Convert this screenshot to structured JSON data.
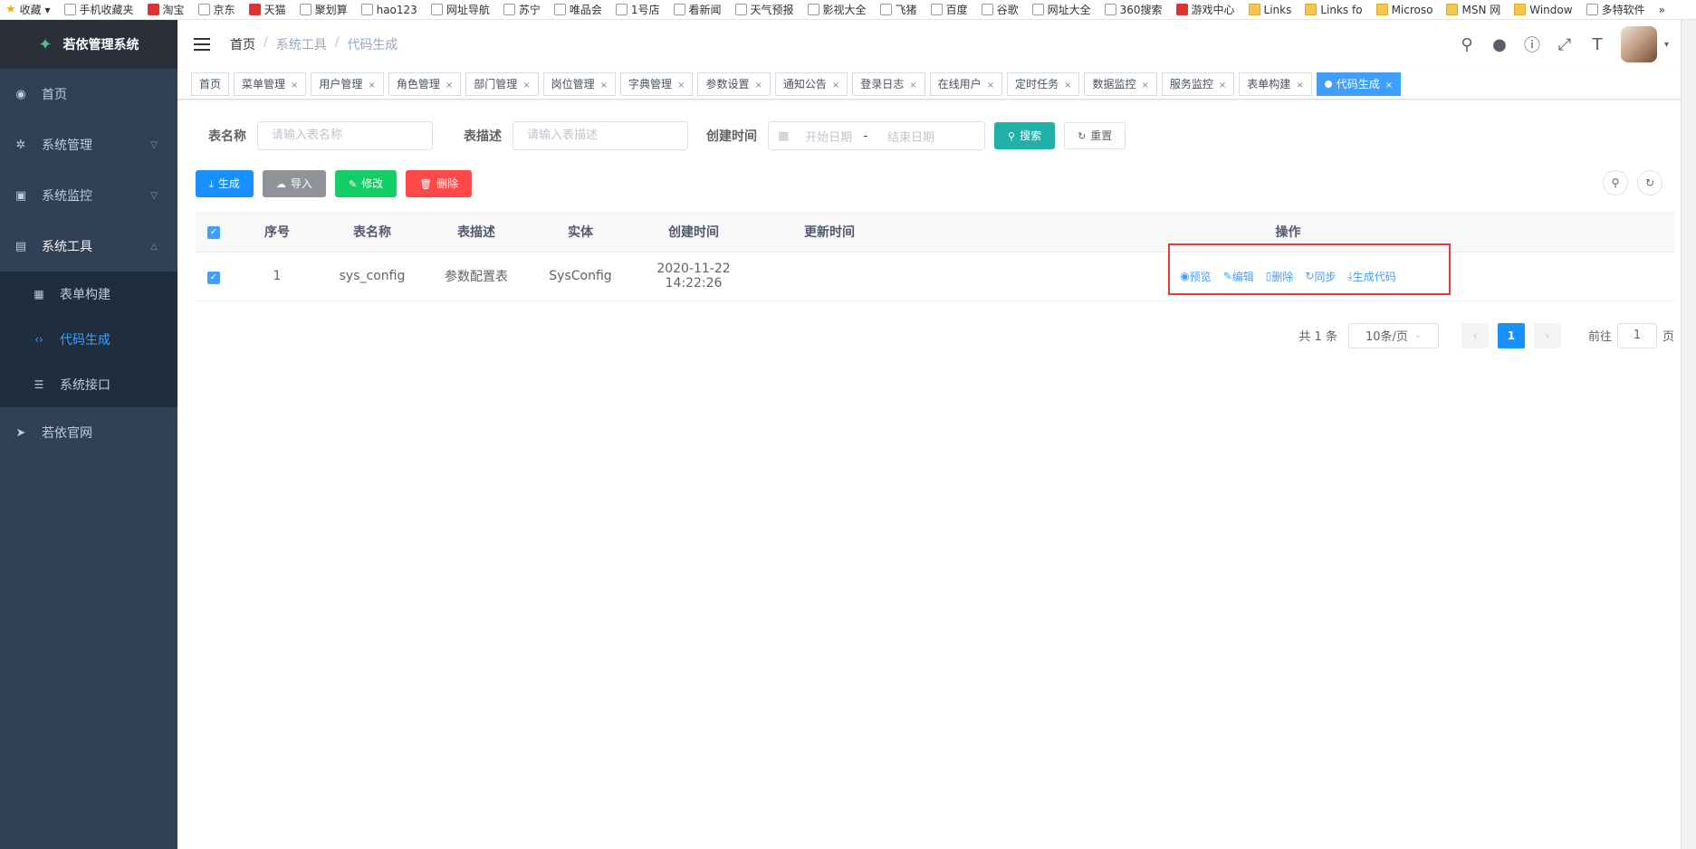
{
  "bookmarks": [
    "收藏",
    "手机收藏夹",
    "淘宝",
    "京东",
    "天猫",
    "聚划算",
    "hao123",
    "网址导航",
    "苏宁",
    "唯品会",
    "1号店",
    "看新闻",
    "天气预报",
    "影视大全",
    "飞猪",
    "百度",
    "谷歌",
    "网址大全",
    "360搜索",
    "游戏中心",
    "Links",
    "Links fo",
    "Microso",
    "MSN 网",
    "Window",
    "多特软件"
  ],
  "bookmarks_more": "»",
  "app_title": "若依管理系统",
  "sidebar": {
    "home": "首页",
    "system": "系统管理",
    "monitor": "系统监控",
    "tools": "系统工具",
    "form_build": "表单构建",
    "code_gen": "代码生成",
    "api": "系统接口",
    "site": "若依官网"
  },
  "breadcrumb": [
    "首页",
    "系统工具",
    "代码生成"
  ],
  "tabs": [
    "首页",
    "菜单管理",
    "用户管理",
    "角色管理",
    "部门管理",
    "岗位管理",
    "字典管理",
    "参数设置",
    "通知公告",
    "登录日志",
    "在线用户",
    "定时任务",
    "数据监控",
    "服务监控",
    "表单构建"
  ],
  "active_tab": "代码生成",
  "search": {
    "table_name_label": "表名称",
    "table_name_placeholder": "请输入表名称",
    "table_desc_label": "表描述",
    "table_desc_placeholder": "请输入表描述",
    "create_time_label": "创建时间",
    "start_date": "开始日期",
    "date_sep": "-",
    "end_date": "结束日期",
    "search_btn": "搜索",
    "reset_btn": "重置"
  },
  "toolbar": {
    "generate": "生成",
    "import": "导入",
    "edit": "修改",
    "delete": "删除"
  },
  "table": {
    "headers": [
      "序号",
      "表名称",
      "表描述",
      "实体",
      "创建时间",
      "更新时间",
      "操作"
    ],
    "rows": [
      {
        "index": "1",
        "table_name": "sys_config",
        "table_desc": "参数配置表",
        "entity": "SysConfig",
        "create_time": "2020-11-22 14:22:26",
        "update_time": ""
      }
    ],
    "actions": [
      "预览",
      "编辑",
      "删除",
      "同步",
      "生成代码"
    ]
  },
  "pagination": {
    "total": "共 1 条",
    "page_size": "10条/页",
    "current": "1",
    "goto_label": "前往",
    "goto_value": "1",
    "page_suffix": "页"
  },
  "colors": {
    "sidebar_bg": "#304156",
    "active": "#409eff",
    "highlight_box": "#e23b3b"
  }
}
